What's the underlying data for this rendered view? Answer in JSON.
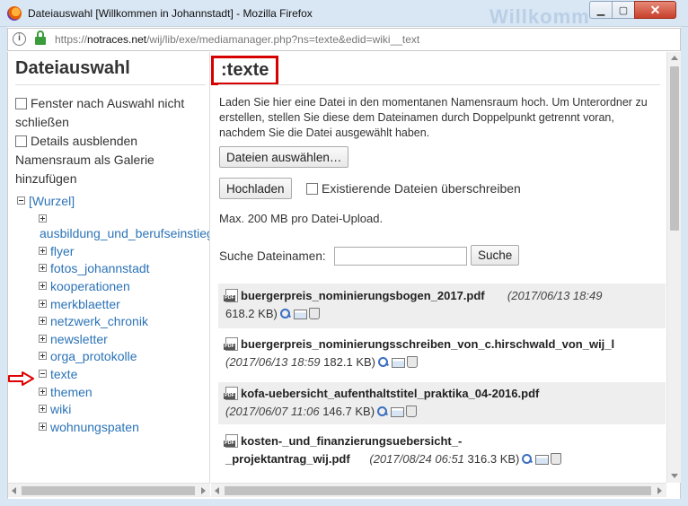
{
  "window": {
    "title": "Dateiauswahl [Willkommen in Johannstadt] - Mozilla Firefox",
    "bg_text": "Willkomm",
    "minimize": "▁",
    "maximize": "▢",
    "close": "✕"
  },
  "urlbar": {
    "prefix": "https://",
    "host": "notraces.net",
    "path": "/wij/lib/exe/mediamanager.php?ns=texte&edid=wiki__text"
  },
  "sidebar": {
    "title": "Dateiauswahl",
    "option_close": "Fenster nach Auswahl nicht schließen",
    "option_details": "Details ausblenden",
    "option_gallery": "Namensraum als Galerie hinzufügen",
    "root": "[Wurzel]",
    "items": [
      {
        "label": "ausbildung_und_berufseinstieg",
        "state": "plus"
      },
      {
        "label": "flyer",
        "state": "plus"
      },
      {
        "label": "fotos_johannstadt",
        "state": "plus"
      },
      {
        "label": "kooperationen",
        "state": "plus"
      },
      {
        "label": "merkblaetter",
        "state": "plus"
      },
      {
        "label": "netzwerk_chronik",
        "state": "plus"
      },
      {
        "label": "newsletter",
        "state": "plus"
      },
      {
        "label": "orga_protokolle",
        "state": "plus"
      },
      {
        "label": "texte",
        "state": "minus"
      },
      {
        "label": "themen",
        "state": "plus"
      },
      {
        "label": "wiki",
        "state": "plus"
      },
      {
        "label": "wohnungspaten",
        "state": "plus"
      }
    ]
  },
  "main": {
    "title": ":texte",
    "description": "Laden Sie hier eine Datei in den momentanen Namensraum hoch. Um Unterordner zu erstellen, stellen Sie diese dem Dateinamen durch Doppelpunkt getrennt voran, nachdem Sie die Datei ausgewählt haben.",
    "select_files": "Dateien auswählen…",
    "upload": "Hochladen",
    "overwrite": "Existierende Dateien überschreiben",
    "max_size": "Max. 200 MB pro Datei-Upload.",
    "search_label": "Suche Dateinamen:",
    "search_value": "",
    "search_button": "Suche",
    "files": [
      {
        "name": "buergerpreis_nominierungsbogen_2017.pdf",
        "date": "(2017/06/13 18:49",
        "size": "618.2 KB)"
      },
      {
        "name": "buergerpreis_nominierungsschreiben_von_c.hirschwald_von_wij_l",
        "date": "(2017/06/13 18:59",
        "size": "182.1 KB)"
      },
      {
        "name": "kofa-uebersicht_aufenthaltstitel_praktika_04-2016.pdf",
        "date": "(2017/06/07 11:06",
        "size": "146.7 KB)"
      },
      {
        "name1": "kosten-_und_finanzierungsuebersicht_-",
        "name2": "_projektantrag_wij.pdf",
        "date": "(2017/08/24 06:51",
        "size": "316.3 KB)"
      }
    ]
  }
}
